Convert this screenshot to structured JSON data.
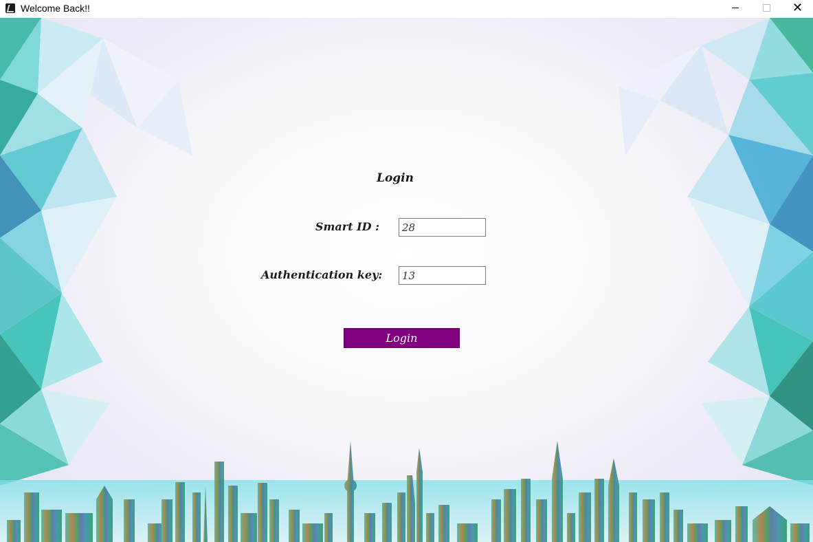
{
  "window": {
    "title": "Welcome Back!!",
    "icon": "app-icon",
    "controls": {
      "minimize_icon": "minimize-icon",
      "maximize_icon": "maximize-icon",
      "close_icon": "close-icon",
      "close_glyph": "✕"
    }
  },
  "form": {
    "heading": "Login",
    "smart_id_label": "Smart ID :",
    "smart_id_value": "28",
    "auth_key_label": "Authentication key:",
    "auth_key_value": "13",
    "submit_label": "Login"
  },
  "colors": {
    "button": "#800080",
    "button_text": "#ffffff",
    "crystal_teal": "#6fd6d8",
    "crystal_blue": "#9ec8ec",
    "skyline_green": "#3f9a6a"
  }
}
